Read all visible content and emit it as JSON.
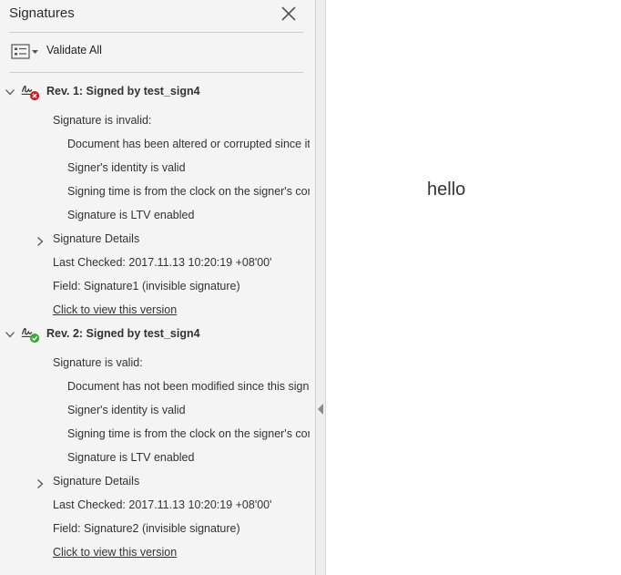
{
  "panel": {
    "title": "Signatures",
    "validate_all_label": "Validate All"
  },
  "revisions": [
    {
      "title": "Rev. 1: Signed by test_sign4",
      "status_icon": "invalid-x-icon",
      "status_color": "#d7191c",
      "status_text": "Signature is invalid:",
      "details": [
        "Document has been altered or corrupted since it w",
        "Signer's identity is valid",
        "Signing time is from the clock on the signer's com",
        "Signature is LTV enabled"
      ],
      "details_toggle": "Signature Details",
      "last_checked": "Last Checked: 2017.11.13 10:20:19 +08'00'",
      "field": "Field: Signature1 (invisible signature)",
      "view_link": "Click to view this version"
    },
    {
      "title": "Rev. 2: Signed by test_sign4",
      "status_icon": "valid-check-icon",
      "status_color": "#3aa935",
      "status_text": "Signature is valid:",
      "details": [
        "Document has not been modified since this signat",
        "Signer's identity is valid",
        "Signing time is from the clock on the signer's com",
        "Signature is LTV enabled"
      ],
      "details_toggle": "Signature Details",
      "last_checked": "Last Checked: 2017.11.13 10:20:19 +08'00'",
      "field": "Field: Signature2 (invisible signature)",
      "view_link": "Click to view this version"
    }
  ],
  "document": {
    "text": "hello"
  }
}
